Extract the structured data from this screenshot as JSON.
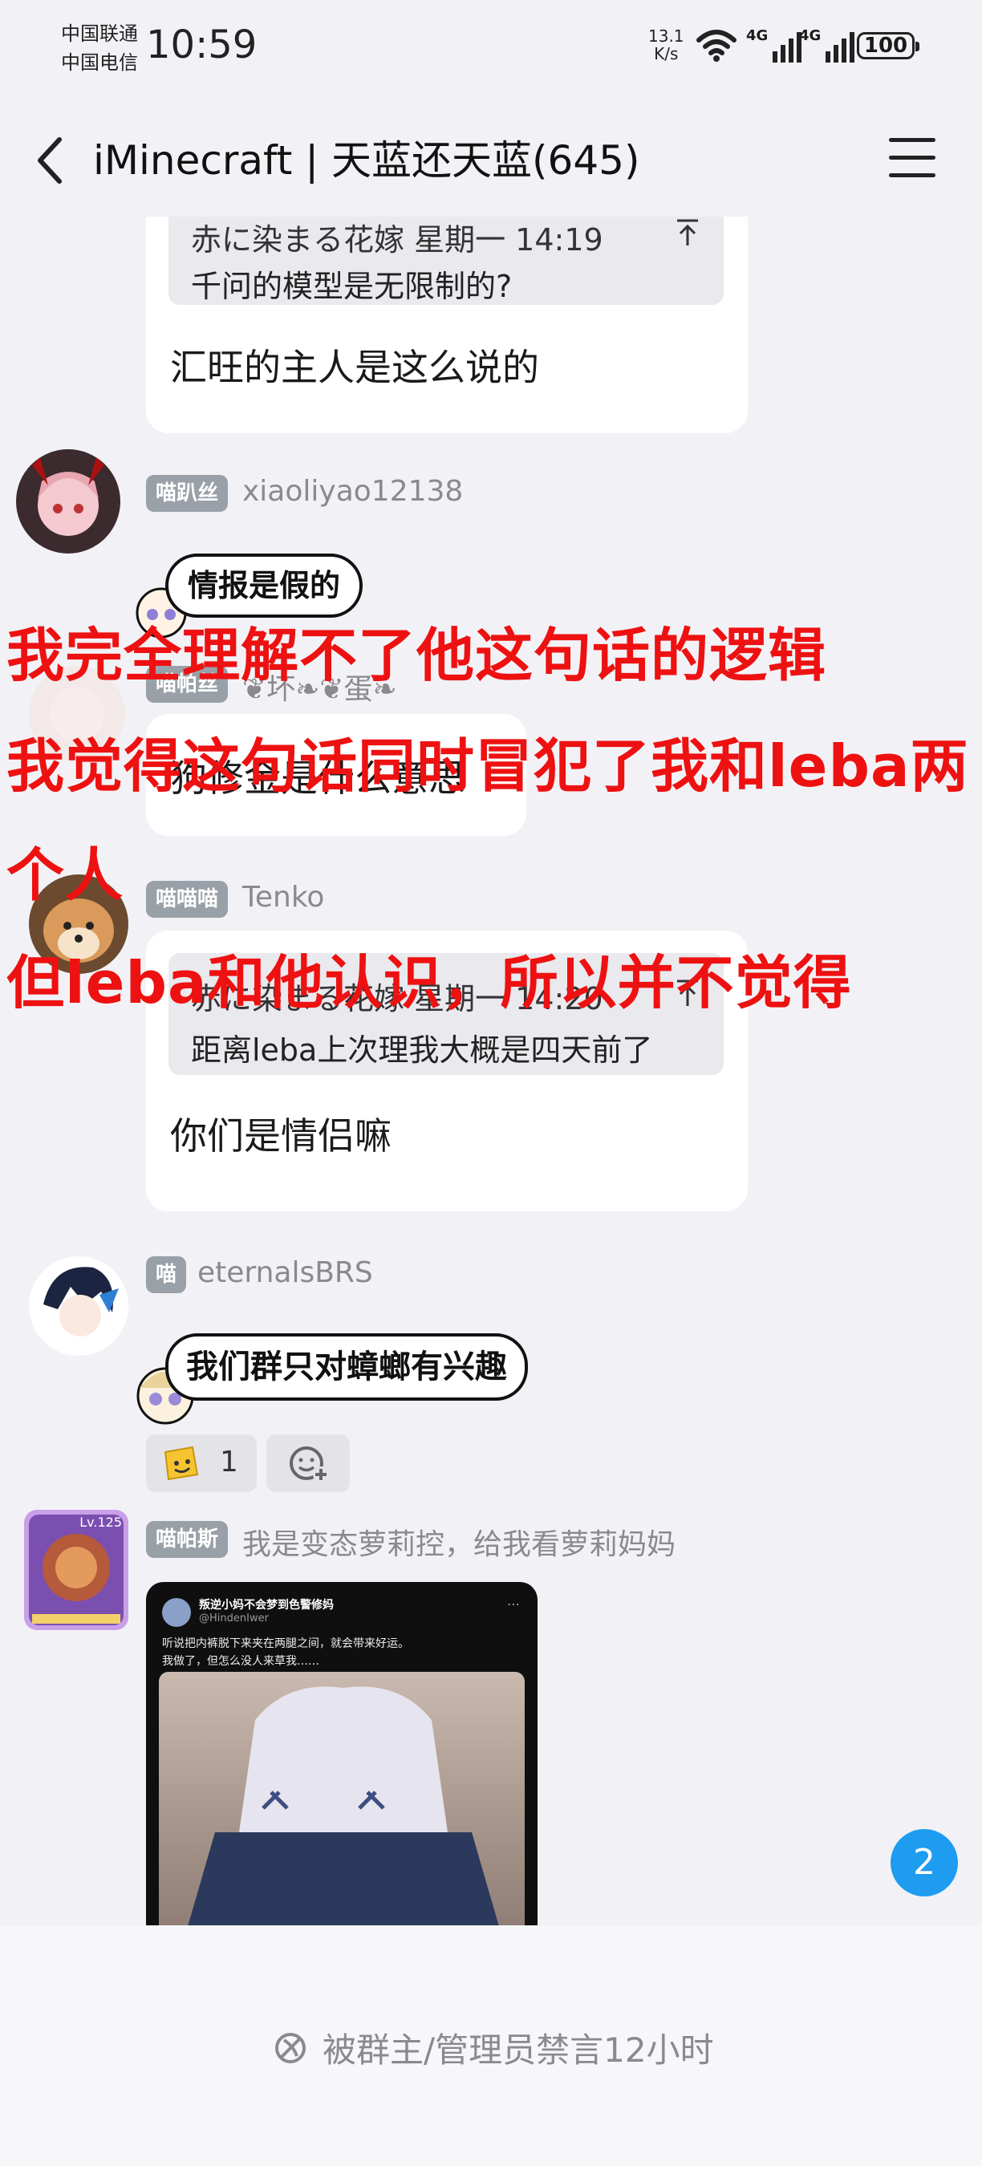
{
  "status_bar": {
    "carrier_1": "中国联通",
    "carrier_2": "中国电信",
    "time": "10:59",
    "net_speed_value": "13.1",
    "net_speed_unit": "K/s",
    "signal_1": "4G",
    "signal_2": "4G",
    "battery": "100"
  },
  "header": {
    "title": "iMinecraft | 天蓝还天蓝(645)"
  },
  "messages": {
    "m1": {
      "quote_author": "赤に染まる花嫁 星期一 14:19",
      "quote_text": "千问的模型是无限制的?",
      "text": "汇旺的主人是这么说的"
    },
    "m2": {
      "tag": "喵趴丝",
      "nick": "xiaoliyao12138",
      "sticker": "情报是假的"
    },
    "m3": {
      "tag": "喵帕丝",
      "nick": "❦坏❧❦蛋❧",
      "text": "狗修金是什么意思"
    },
    "m4": {
      "tag": "喵喵喵",
      "nick": "Tenko",
      "quote_author": "赤に染まる花嫁 星期一 14:20",
      "quote_text": "距离leba上次理我大概是四天前了",
      "text": "你们是情侣嘛"
    },
    "m5": {
      "tag": "喵",
      "nick": "eternalsBRS",
      "sticker": "我们群只对蟑螂有兴趣",
      "reaction_count": "1"
    },
    "m6": {
      "tag": "喵帕斯",
      "nick": "我是变态萝莉控，给我看萝莉妈妈",
      "level": "Lv.125",
      "image_author": "叛逆小妈不会梦到色警修妈",
      "image_handle": "@HindenIwer",
      "image_line1": "听说把内裤脱下来夹在两腿之间，就会带来好运。",
      "image_line2": "我做了，但怎么没人来草我……"
    }
  },
  "overlay": {
    "line1": "我完全理解不了他这句话的逻辑",
    "line2": "我觉得这句话同时冒犯了我和leba两",
    "line3": "个人",
    "line4": "但leba和他认识，所以并不觉得"
  },
  "unread_badge": "2",
  "footer": {
    "muted_text": "被群主/管理员禁言12小时"
  },
  "colors": {
    "overlay_text": "#ee1111",
    "badge": "#1e9cf0",
    "background": "#f2f2f6"
  }
}
